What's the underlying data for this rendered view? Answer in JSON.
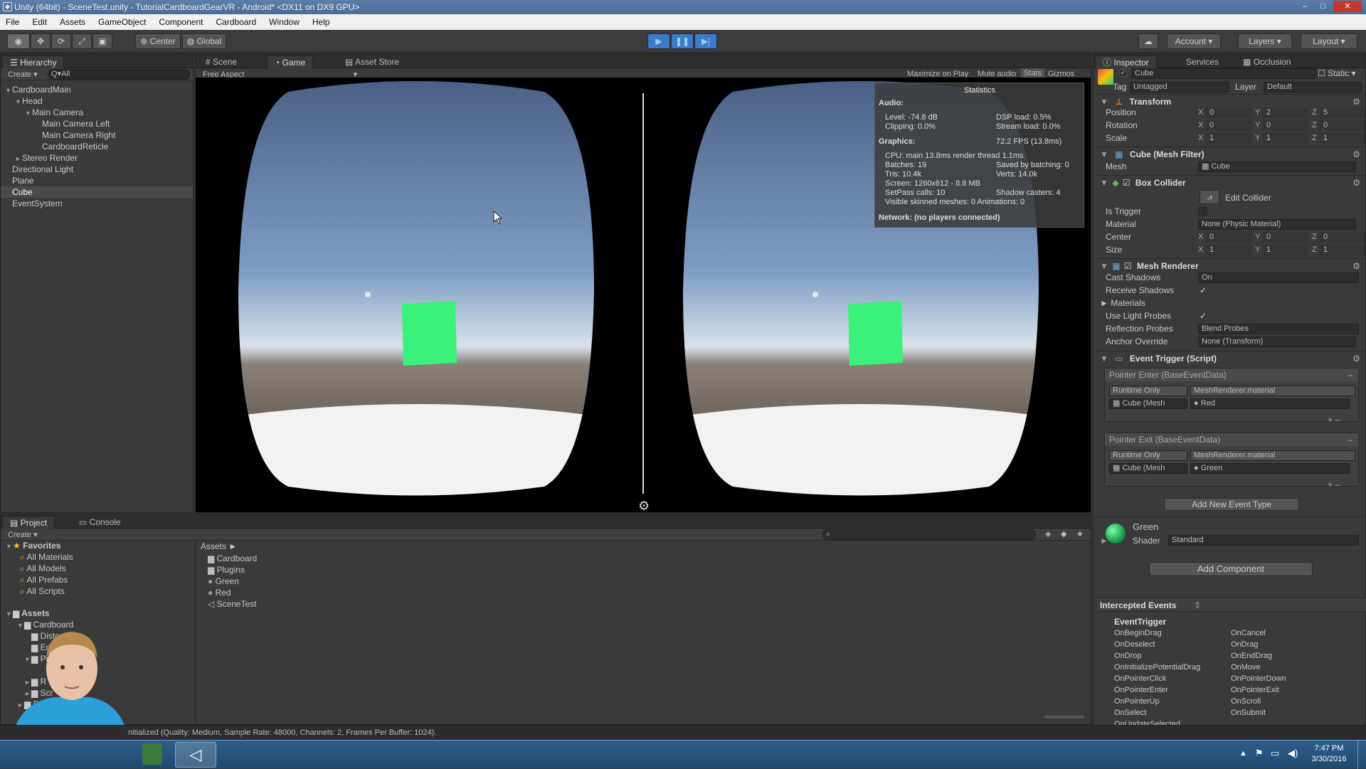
{
  "window": {
    "title": "Unity (64bit) - SceneTest.unity - TutorialCardboardGearVR - Android* <DX11 on DX9 GPU>",
    "controls": [
      "–",
      "□",
      "✕"
    ]
  },
  "menu": [
    "File",
    "Edit",
    "Assets",
    "GameObject",
    "Component",
    "Cardboard",
    "Window",
    "Help"
  ],
  "toolbar": {
    "pivot": "Center",
    "space": "Global",
    "account": "Account",
    "layers": "Layers",
    "layout": "Layout"
  },
  "hierarchy": {
    "tab": "Hierarchy",
    "create": "Create",
    "search_placeholder": "Q▾All",
    "items": [
      {
        "label": "CardboardMain",
        "depth": 0,
        "arrow": "▼"
      },
      {
        "label": "Head",
        "depth": 1,
        "arrow": "▼"
      },
      {
        "label": "Main Camera",
        "depth": 2,
        "arrow": "▼"
      },
      {
        "label": "Main Camera Left",
        "depth": 3,
        "arrow": ""
      },
      {
        "label": "Main Camera Right",
        "depth": 3,
        "arrow": ""
      },
      {
        "label": "CardboardReticle",
        "depth": 3,
        "arrow": ""
      },
      {
        "label": "Stereo Render",
        "depth": 1,
        "arrow": "►"
      },
      {
        "label": "Directional Light",
        "depth": 0,
        "arrow": ""
      },
      {
        "label": "Plane",
        "depth": 0,
        "arrow": ""
      },
      {
        "label": "Cube",
        "depth": 0,
        "arrow": "",
        "selected": true
      },
      {
        "label": "EventSystem",
        "depth": 0,
        "arrow": ""
      }
    ]
  },
  "center_tabs": {
    "scene": "Scene",
    "game": "Game",
    "asset_store": "Asset Store"
  },
  "game_bar": {
    "aspect": "Free Aspect",
    "maximize": "Maximize on Play",
    "mute": "Mute audio",
    "stats": "Stats",
    "gizmos": "Gizmos"
  },
  "stats": {
    "title": "Statistics",
    "audio_heading": "Audio:",
    "level": "Level: -74.8 dB",
    "clipping": "Clipping: 0.0%",
    "dsp": "DSP load: 0.5%",
    "stream": "Stream load: 0.0%",
    "graphics_heading": "Graphics:",
    "fps": "72.2 FPS (13.8ms)",
    "cpu": "CPU: main 13.8ms  render thread 1.1ms",
    "batches": "Batches: 19",
    "saved": "Saved by batching: 0",
    "tris": "Tris: 10.4k",
    "verts": "Verts: 14.0k",
    "screen": "Screen: 1260x612 - 8.8 MB",
    "setpass": "SetPass calls: 10",
    "shadow_casters": "Shadow casters: 4",
    "skinned": "Visible skinned meshes: 0  Animations: 0",
    "network": "Network: (no players connected)"
  },
  "inspector": {
    "tabs": {
      "inspector": "Inspector",
      "services": "Services",
      "occlusion": "Occlusion"
    },
    "object_name": "Cube",
    "static": "Static",
    "tag_label": "Tag",
    "tag_value": "Untagged",
    "layer_label": "Layer",
    "layer_value": "Default",
    "transform": {
      "title": "Transform",
      "rows": [
        {
          "label": "Position",
          "x": "0",
          "y": "2",
          "z": "5"
        },
        {
          "label": "Rotation",
          "x": "0",
          "y": "0",
          "z": "0"
        },
        {
          "label": "Scale",
          "x": "1",
          "y": "1",
          "z": "1"
        }
      ]
    },
    "mesh_filter": {
      "title": "Cube (Mesh Filter)",
      "mesh_label": "Mesh",
      "mesh_value": "Cube"
    },
    "box_collider": {
      "title": "Box Collider",
      "edit": "Edit Collider",
      "is_trigger": "Is Trigger",
      "material_label": "Material",
      "material_value": "None (Physic Material)",
      "center_label": "Center",
      "center": {
        "x": "0",
        "y": "0",
        "z": "0"
      },
      "size_label": "Size",
      "size": {
        "x": "1",
        "y": "1",
        "z": "1"
      }
    },
    "mesh_renderer": {
      "title": "Mesh Renderer",
      "cast_shadows_label": "Cast Shadows",
      "cast_shadows": "On",
      "receive_shadows": "Receive Shadows",
      "materials": "Materials",
      "light_probes": "Use Light Probes",
      "reflection_label": "Reflection Probes",
      "reflection": "Blend Probes",
      "anchor_label": "Anchor Override",
      "anchor": "None (Transform)"
    },
    "event_trigger": {
      "title": "Event Trigger (Script)",
      "entries": [
        {
          "header": "Pointer Enter (BaseEventData)",
          "mode": "Runtime Only",
          "func": "MeshRenderer.material",
          "target": "Cube (Mesh",
          "arg": "Red"
        },
        {
          "header": "Pointer Exit (BaseEventData)",
          "mode": "Runtime Only",
          "func": "MeshRenderer.material",
          "target": "Cube (Mesh",
          "arg": "Green"
        }
      ],
      "add_event": "Add New Event Type"
    },
    "material": {
      "name": "Green",
      "shader_label": "Shader",
      "shader": "Standard"
    },
    "add_component": "Add Component",
    "intercepted": {
      "title": "Intercepted Events",
      "class": "EventTrigger",
      "left": [
        "OnBeginDrag",
        "OnDeselect",
        "OnDrop",
        "OnInitializePotentialDrag",
        "OnPointerClick",
        "OnPointerEnter",
        "OnPointerUp",
        "OnSelect",
        "OnUpdateSelected"
      ],
      "right": [
        "OnCancel",
        "OnDrag",
        "OnEndDrag",
        "OnMove",
        "OnPointerDown",
        "OnPointerExit",
        "OnScroll",
        "OnSubmit"
      ]
    }
  },
  "project": {
    "tabs": {
      "project": "Project",
      "console": "Console"
    },
    "create": "Create",
    "favorites_title": "Favorites",
    "favorites": [
      "All Materials",
      "All Models",
      "All Prefabs",
      "All Scripts"
    ],
    "assets_title": "Assets",
    "asset_tree": [
      "Cardboard",
      "Disto",
      "Ed",
      "Pr",
      "R",
      "Scr",
      "Plugi"
    ],
    "breadcrumb": "Assets ►",
    "files": [
      {
        "name": "Cardboard",
        "kind": "folder"
      },
      {
        "name": "Plugins",
        "kind": "folder"
      },
      {
        "name": "Green",
        "kind": "material"
      },
      {
        "name": "Red",
        "kind": "material"
      },
      {
        "name": "SceneTest",
        "kind": "scene"
      }
    ]
  },
  "status": "nitialized (Quality: Medium, Sample Rate: 48000, Channels: 2, Frames Per Buffer: 1024).",
  "taskbar": {
    "time": "7:47 PM",
    "date": "3/30/2016"
  },
  "colors": {
    "cube": "#3af27a",
    "accent": "#4a8ad0",
    "background": "#383838"
  }
}
